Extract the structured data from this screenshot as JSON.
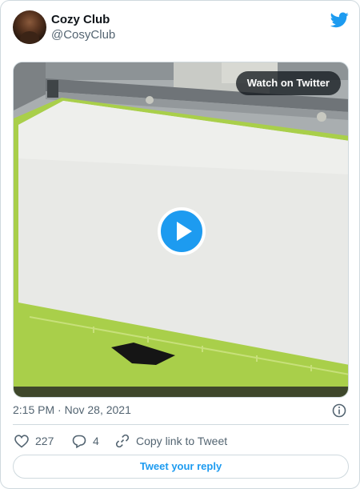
{
  "author": {
    "display_name": "Cozy Club",
    "handle": "@CosyClub"
  },
  "media": {
    "watch_label": "Watch on Twitter"
  },
  "meta": {
    "timestamp": "2:15 PM · Nov 28, 2021"
  },
  "actions": {
    "likes": "227",
    "replies": "4",
    "copy_link": "Copy link to Tweet"
  },
  "reply": {
    "label": "Tweet your reply"
  },
  "colors": {
    "accent": "#1d9bf0",
    "mat_green": "#a9cf4a"
  },
  "icons": [
    "twitter-bird-icon",
    "play-icon",
    "info-icon",
    "heart-icon",
    "reply-bubble-icon",
    "link-icon"
  ]
}
